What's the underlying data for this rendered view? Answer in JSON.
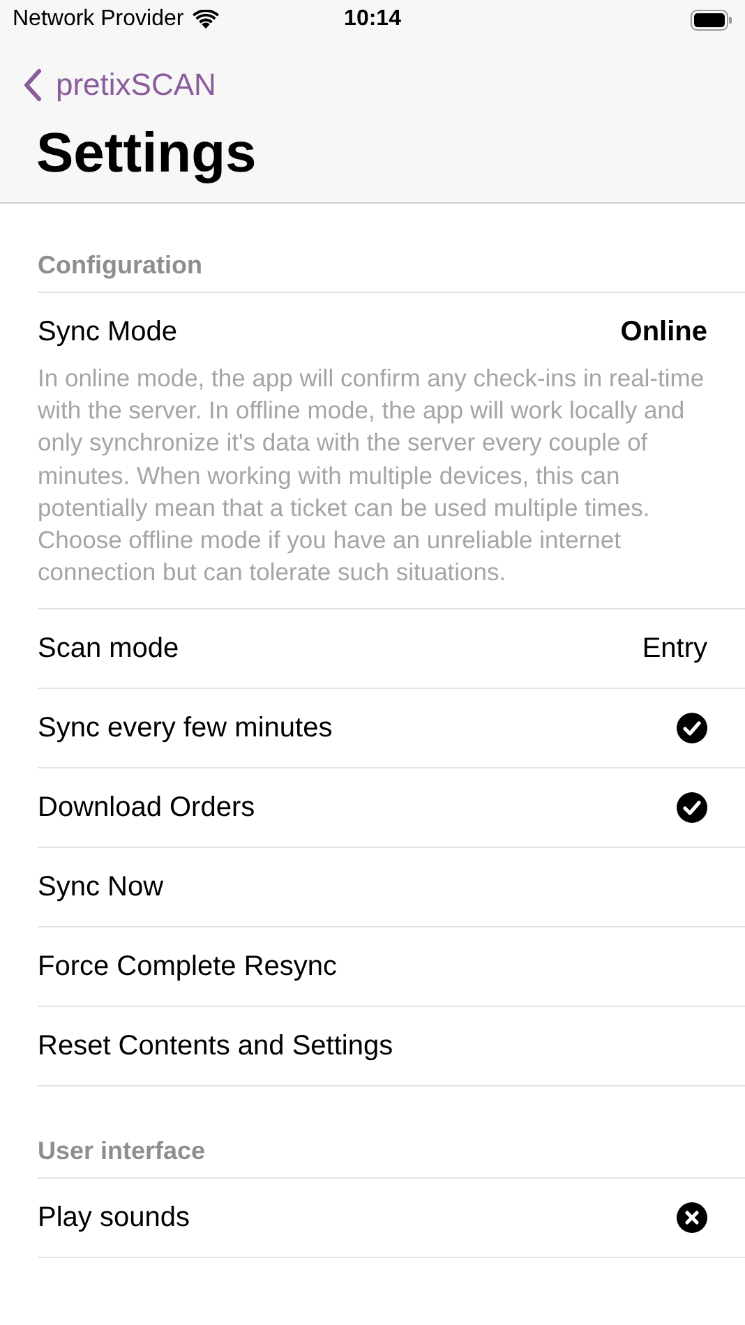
{
  "status_bar": {
    "carrier": "Network Provider",
    "time": "10:14"
  },
  "nav": {
    "back_label": "pretixSCAN",
    "title": "Settings"
  },
  "sections": [
    {
      "header": "Configuration",
      "rows": [
        {
          "kind": "value",
          "label": "Sync Mode",
          "value": "Online",
          "value_bold": true,
          "description": "In online mode, the app will confirm any check-ins in real-time with the server. In offline mode, the app will work locally and only synchronize it's data with the server every couple of minutes. When working with multiple devices, this can potentially mean that a ticket can be used multiple times. Choose offline mode if you have an unreliable internet connection but can tolerate such situations."
        },
        {
          "kind": "value",
          "label": "Scan mode",
          "value": "Entry",
          "value_bold": false
        },
        {
          "kind": "toggle",
          "label": "Sync every few minutes",
          "checked": true
        },
        {
          "kind": "toggle",
          "label": "Download Orders",
          "checked": true
        },
        {
          "kind": "action",
          "label": "Sync Now"
        },
        {
          "kind": "action",
          "label": "Force Complete Resync"
        },
        {
          "kind": "action",
          "label": "Reset Contents and Settings"
        }
      ]
    },
    {
      "header": "User interface",
      "rows": [
        {
          "kind": "toggle",
          "label": "Play sounds",
          "checked": false
        }
      ]
    }
  ]
}
